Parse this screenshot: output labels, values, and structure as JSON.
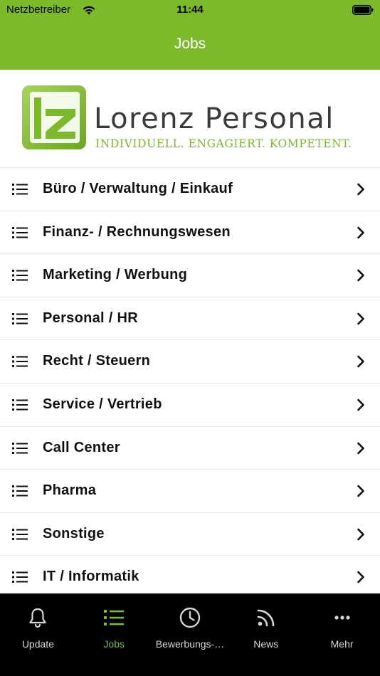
{
  "status_bar": {
    "carrier": "Netzbetreiber",
    "time": "11:44",
    "wifi_icon": "wifi-icon",
    "battery_icon": "battery-icon"
  },
  "nav": {
    "title": "Jobs"
  },
  "logo": {
    "name": "Lorenz Personal",
    "tagline": "INDIVIDUELL. ENGAGIERT. KOMPETENT.",
    "mark_letters": "lz"
  },
  "categories": [
    {
      "label": "Büro / Verwaltung / Einkauf"
    },
    {
      "label": "Finanz- / Rechnungswesen"
    },
    {
      "label": "Marketing / Werbung"
    },
    {
      "label": "Personal / HR"
    },
    {
      "label": "Recht / Steuern"
    },
    {
      "label": "Service / Vertrieb"
    },
    {
      "label": "Call Center"
    },
    {
      "label": "Pharma"
    },
    {
      "label": "Sonstige"
    },
    {
      "label": "IT / Informatik"
    }
  ],
  "tabs": [
    {
      "label": "Update",
      "icon": "bell-icon",
      "active": false
    },
    {
      "label": "Jobs",
      "icon": "list-icon",
      "active": true
    },
    {
      "label": "Bewerbungs-…",
      "icon": "clock-icon",
      "active": false
    },
    {
      "label": "News",
      "icon": "rss-icon",
      "active": false
    },
    {
      "label": "Mehr",
      "icon": "more-icon",
      "active": false
    }
  ],
  "colors": {
    "brand_green": "#7cba2b",
    "tab_bar_bg": "#000000",
    "tab_inactive": "#d6d6d6"
  }
}
